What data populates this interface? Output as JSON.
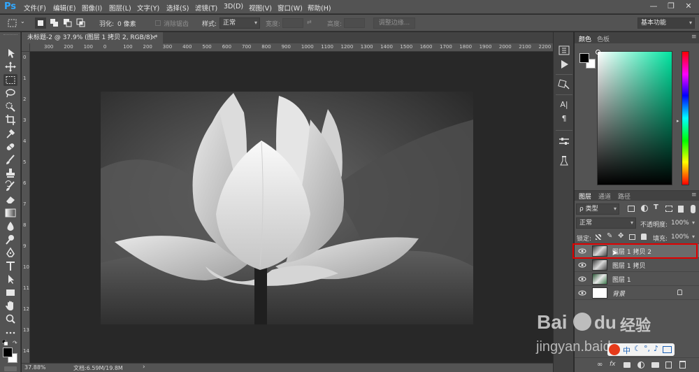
{
  "app": {
    "logo": "Ps",
    "menu": [
      "文件(F)",
      "编辑(E)",
      "图像(I)",
      "图层(L)",
      "文字(Y)",
      "选择(S)",
      "滤镜(T)",
      "3D(D)",
      "视图(V)",
      "窗口(W)",
      "帮助(H)"
    ],
    "window_controls": [
      "—",
      "❐",
      "✕"
    ]
  },
  "options_bar": {
    "feather_label": "羽化:",
    "feather_value": "0 像素",
    "antialias_label": "消除锯齿",
    "style_label": "样式:",
    "style_value": "正常",
    "width_label": "宽度:",
    "height_label": "高度:",
    "refine_edge_label": "调整边缘...",
    "workspace_value": "基本功能"
  },
  "document": {
    "tab_title": "未标题-2 @ 37.9% (图层 1 拷贝 2, RGB/8) *",
    "tab_close": "×"
  },
  "ruler": {
    "top_labels": [
      "300",
      "200",
      "100",
      "0",
      "100",
      "200",
      "300",
      "400",
      "500",
      "600",
      "700",
      "800",
      "900",
      "1000",
      "1100",
      "1200",
      "1300",
      "1400",
      "1500",
      "1600",
      "1700",
      "1800",
      "1900",
      "2000",
      "2100",
      "2200"
    ],
    "left_labels": [
      "0",
      "1",
      "2",
      "3",
      "4",
      "5",
      "6",
      "7",
      "8",
      "9",
      "10",
      "11",
      "12",
      "13",
      "14"
    ]
  },
  "status": {
    "zoom": "37.88%",
    "doc_info": "文档:6.59M/19.8M",
    "arrow": "›"
  },
  "color_panel": {
    "tabs": [
      "颜色",
      "色板"
    ]
  },
  "layers_panel": {
    "tabs": [
      "图层",
      "通道",
      "路径"
    ],
    "filter_kind": "ρ 类型",
    "blend_mode": "正常",
    "opacity_label": "不透明度:",
    "opacity_value": "100%",
    "lock_label": "锁定:",
    "fill_label": "填充:",
    "fill_value": "100%",
    "layers": [
      {
        "name": "图层 1 拷贝 2",
        "selected": true
      },
      {
        "name": "图层 1 拷贝",
        "selected": false
      },
      {
        "name": "图层 1",
        "selected": false
      },
      {
        "name": "背景",
        "selected": false
      }
    ],
    "footer_icons": [
      "link-icon",
      "fx-icon",
      "mask-icon",
      "adjustment-icon",
      "folder-icon",
      "new-layer-icon",
      "trash-icon"
    ]
  },
  "watermark": {
    "brand": "Bai",
    "brand2": "经验",
    "url": "jingyan.baidu.com"
  },
  "colors": {
    "accent": "#31a8ff",
    "highlight": "#e00000",
    "panel": "#535353",
    "canvas_bg": "#282828"
  }
}
